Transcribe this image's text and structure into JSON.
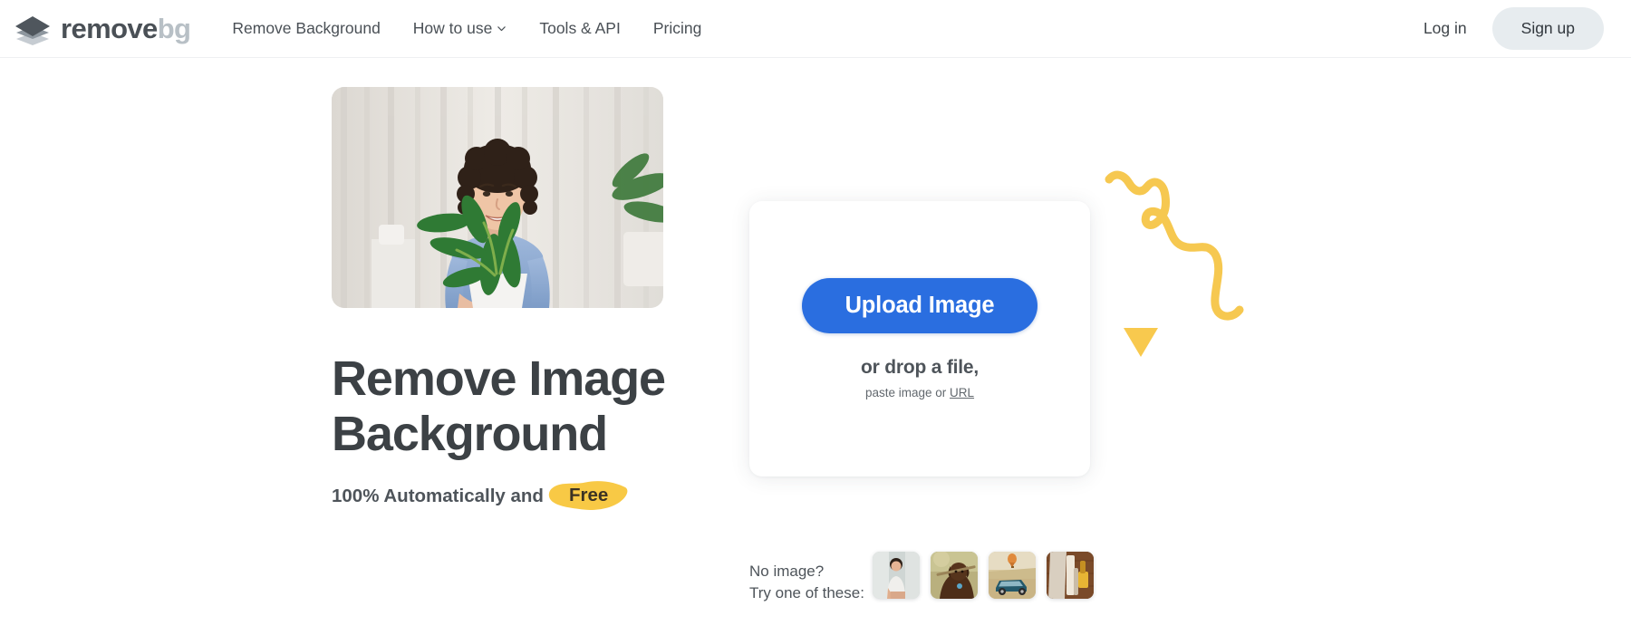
{
  "brand": {
    "logo_icon": "layers-diamond-icon",
    "name_primary": "remove",
    "name_secondary": "bg"
  },
  "header": {
    "nav": [
      {
        "label": "Remove Background",
        "icon": null
      },
      {
        "label": "How to use",
        "icon": "chevron-down-icon"
      },
      {
        "label": "Tools & API",
        "icon": null
      },
      {
        "label": "Pricing",
        "icon": null
      }
    ],
    "login_label": "Log in",
    "signup_label": "Sign up",
    "signup_bg": "#e7ecef"
  },
  "hero": {
    "photo_alt": "man-holding-plant-photo",
    "title_line1": "Remove Image",
    "title_line2": "Background",
    "subtitle_prefix": "100% Automatically and",
    "badge_label": "Free",
    "badge_color": "#f8c945",
    "title_color": "#3c4145"
  },
  "upload": {
    "button_label": "Upload Image",
    "button_color": "#2a6ee0",
    "drop_label": "or drop a file,",
    "paste_prefix": "paste image or",
    "paste_link_label": "URL"
  },
  "samples": {
    "label_line1": "No image?",
    "label_line2": "Try one of these:",
    "thumbnails": [
      {
        "name": "sample-man-sitting"
      },
      {
        "name": "sample-dog-with-stick"
      },
      {
        "name": "sample-car-hot-air-balloon"
      },
      {
        "name": "sample-paint-roller"
      }
    ]
  },
  "decoration": {
    "squiggle_name": "yellow-squiggle-decoration",
    "triangle_name": "yellow-triangle-decoration",
    "color": "#f6c850"
  }
}
